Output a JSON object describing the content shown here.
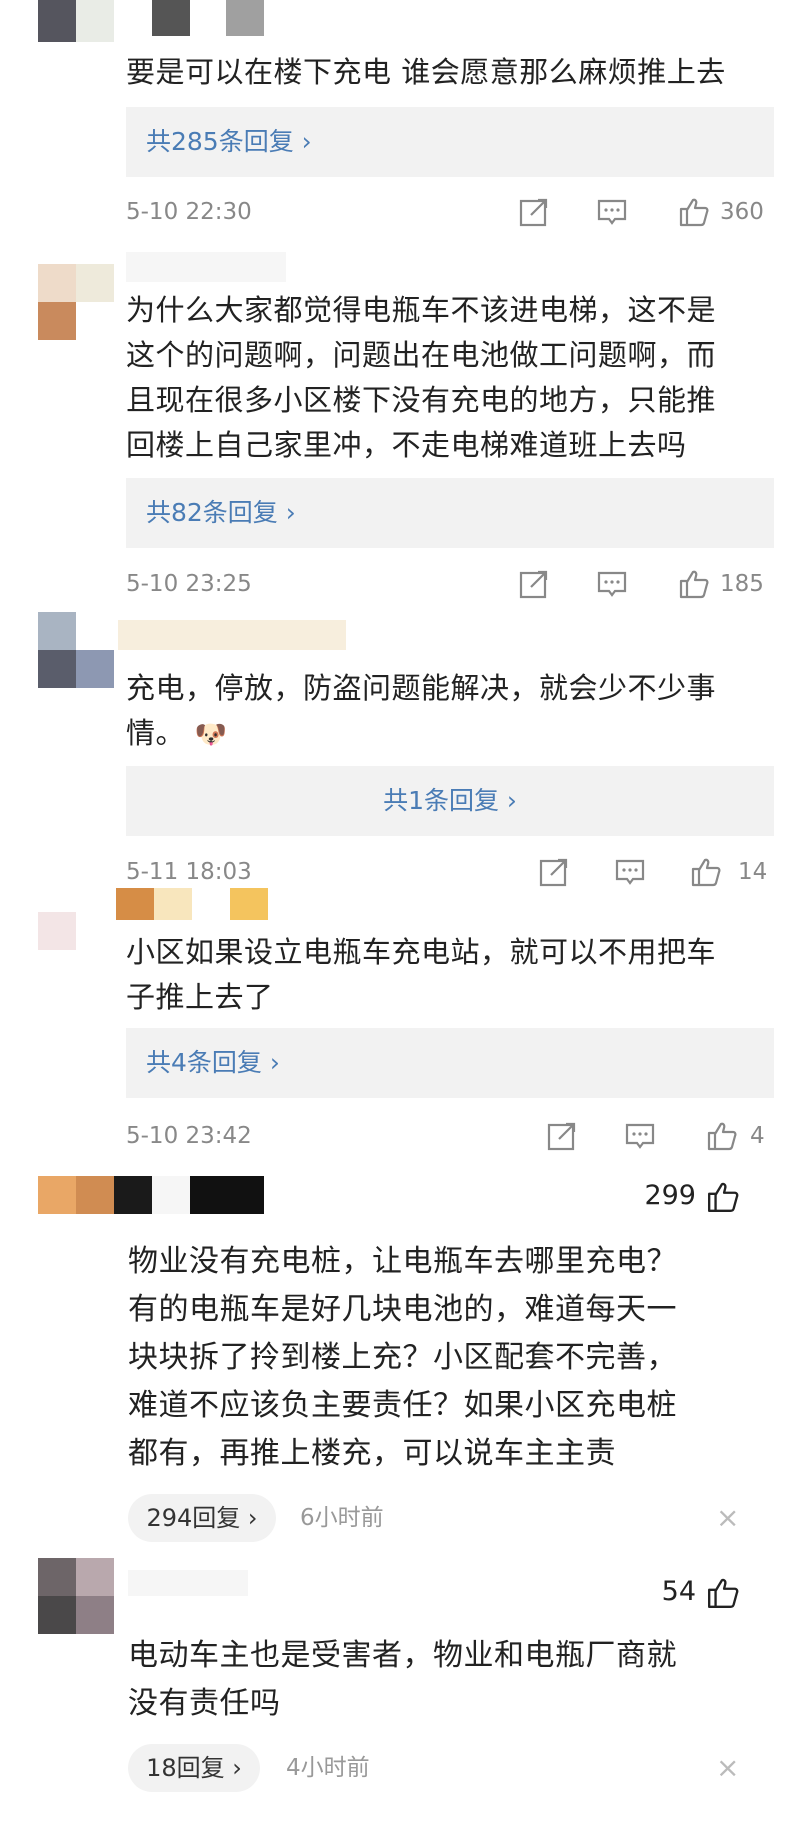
{
  "comments": [
    {
      "text_lines": [
        "要是可以在楼下充电 谁会愿意那么麻烦推上去"
      ],
      "reply_label": "共285条回复 ›",
      "date": "5-10 22:30",
      "likes": "360"
    },
    {
      "text_lines": [
        "为什么大家都觉得电瓶车不该进电梯，这不是",
        "这个的问题啊，问题出在电池做工问题啊，而",
        "且现在很多小区楼下没有充电的地方，只能推",
        "回楼上自己家里冲，不走电梯难道班上去吗"
      ],
      "reply_label": "共82条回复 ›",
      "date": "5-10 23:25",
      "likes": "185"
    },
    {
      "text_lines": [
        "充电，停放，防盗问题能解决，就会少不少事",
        "情。"
      ],
      "emoji": "🐶",
      "reply_label": "共1条回复 ›",
      "date": "5-11 18:03",
      "likes": "14"
    },
    {
      "text_lines": [
        "小区如果设立电瓶车充电站，就可以不用把车",
        "子推上去了"
      ],
      "reply_label": "共4条回复 ›",
      "date": "5-10 23:42",
      "likes": "4"
    }
  ],
  "comments_b": [
    {
      "likes": "299",
      "text_lines": [
        "物业没有充电桩，让电瓶车去哪里充电？",
        "有的电瓶车是好几块电池的，难道每天一",
        "块块拆了拎到楼上充？小区配套不完善，",
        "难道不应该负主要责任？如果小区充电桩",
        "都有，再推上楼充，可以说车主主责"
      ],
      "reply_pill": "294回复 ›",
      "ago": "6小时前",
      "close": "×"
    },
    {
      "likes": "54",
      "text_lines": [
        "电动车主也是受害者，物业和电瓶厂商就",
        "没有责任吗"
      ],
      "reply_pill": "18回复 ›",
      "ago": "4小时前",
      "close": "×"
    }
  ],
  "colors": {
    "link": "#4a7cb5",
    "meta_gray": "#888888",
    "reply_bg": "#f2f2f2"
  }
}
